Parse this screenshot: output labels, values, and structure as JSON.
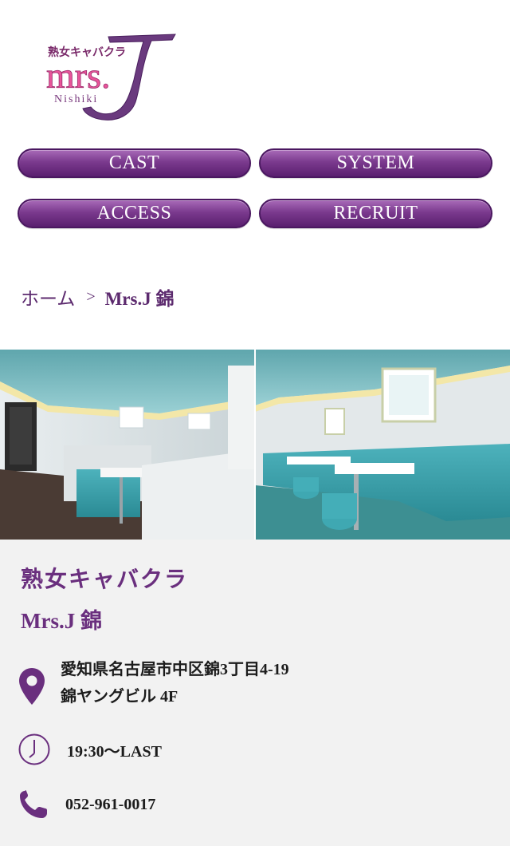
{
  "logo": {
    "top_text": "熟女キャバクラ",
    "brand": "mrs.",
    "letter": "J",
    "sub": "Nishiki"
  },
  "nav": {
    "items": [
      {
        "label": "CAST"
      },
      {
        "label": "SYSTEM"
      },
      {
        "label": "ACCESS"
      },
      {
        "label": "RECRUIT"
      }
    ]
  },
  "breadcrumb": {
    "home": "ホーム",
    "separator": ">",
    "current": "Mrs.J 錦"
  },
  "shop": {
    "category": "熟女キャバクラ",
    "name": "Mrs.J 錦",
    "address_line1": "愛知県名古屋市中区錦3丁目4-19",
    "address_line2": "錦ヤングビル 4F",
    "hours": "19:30〜LAST",
    "phone": "052-961-0017"
  },
  "colors": {
    "accent": "#6a2f7e",
    "button": "#7b3a8e",
    "info_bg": "#f2f2f2"
  },
  "icons": {
    "address": "map-pin-icon",
    "hours": "clock-icon",
    "phone": "phone-icon"
  }
}
